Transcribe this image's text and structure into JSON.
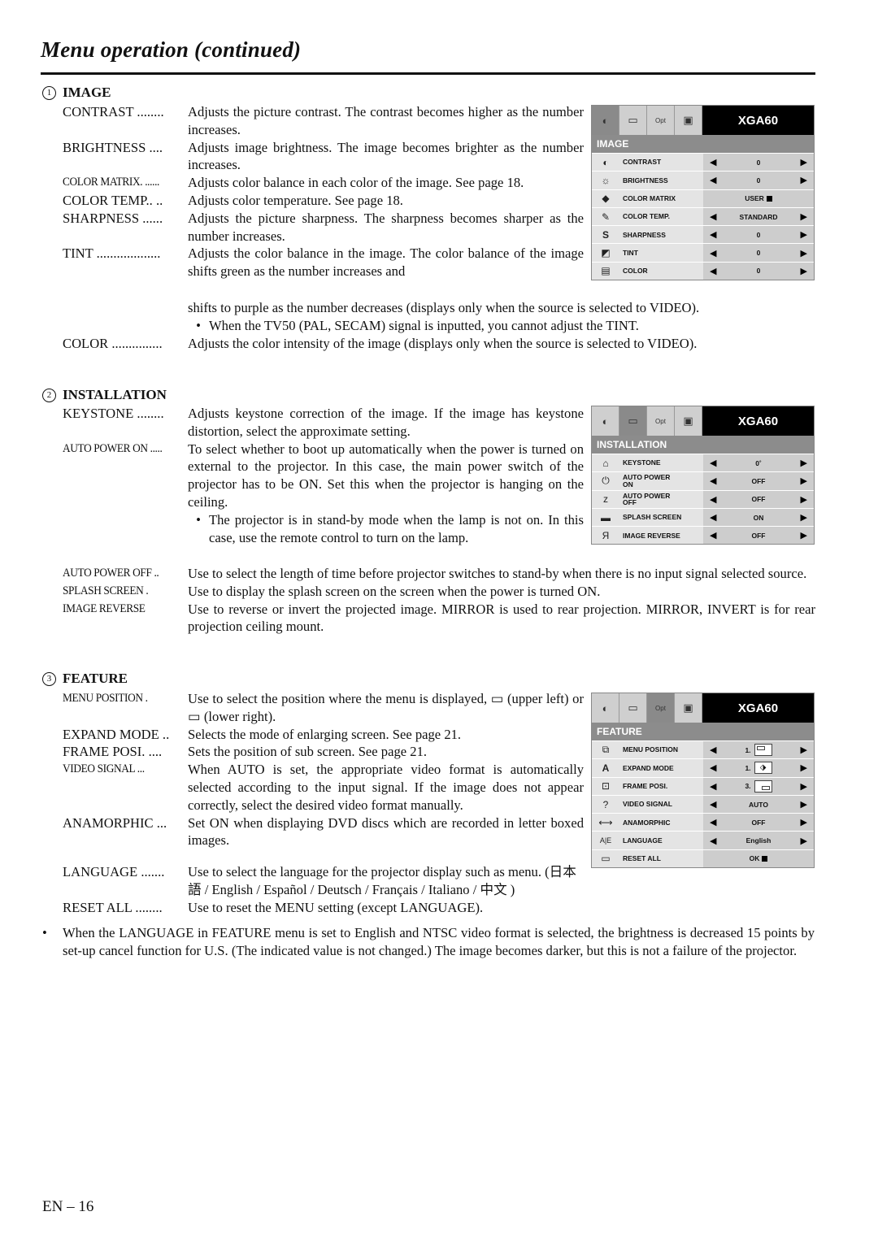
{
  "page": {
    "title": "Menu operation (continued)",
    "footer": "EN – 16"
  },
  "sections": {
    "image": {
      "num": "1",
      "heading": "IMAGE",
      "entries": [
        {
          "term": "CONTRAST ........",
          "desc": "Adjusts the picture contrast. The contrast becomes higher as the number increases."
        },
        {
          "term": "BRIGHTNESS ....",
          "desc": "Adjusts image brightness. The image becomes brighter as the number increases."
        },
        {
          "term": "COLOR MATRIX. ......",
          "desc": "Adjusts color balance in each color of the image. See page 18."
        },
        {
          "term": "COLOR TEMP.. ..",
          "desc": "Adjusts color temperature. See page 18."
        },
        {
          "term": "SHARPNESS ......",
          "desc": "Adjusts the picture sharpness. The sharpness becomes sharper as the number increases."
        },
        {
          "term": "TINT ...................",
          "desc": "Adjusts the color balance in the image. The color balance of the image shifts green as the number increases and"
        },
        {
          "term": "COLOR ...............",
          "desc": "Adjusts the color intensity of the image (displays only when the source is selected to VIDEO)."
        }
      ],
      "tint_continued": "shifts to purple as the number decreases (displays only when the source is selected to VIDEO).",
      "tint_bullet": "When the TV50 (PAL, SECAM) signal is inputted, you cannot adjust the TINT."
    },
    "installation": {
      "num": "2",
      "heading": "INSTALLATION",
      "entries": [
        {
          "term": "KEYSTONE ........",
          "desc": "Adjusts keystone correction of the image. If the image has keystone distortion, select the approximate setting."
        },
        {
          "term": "AUTO POWER ON .....",
          "desc": "To select whether to boot up automatically when the power is turned on external to the projector. In this case, the main power switch of the projector has to be ON. Set this when the projector is hanging on the ceiling."
        },
        {
          "term": "AUTO POWER OFF ..",
          "desc": "Use to select the length of time before projector switches to stand-by when there is no input signal selected source."
        },
        {
          "term": "SPLASH SCREEN .",
          "desc": "Use to display the splash screen on the screen when the power is turned ON."
        },
        {
          "term": "IMAGE REVERSE",
          "desc": "Use to reverse or invert the projected image.  MIRROR is used to rear projection. MIRROR, INVERT is for rear projection ceiling mount."
        }
      ],
      "power_on_bullet": "The projector is in stand-by mode when the lamp is not on. In this case, use the remote control to turn on the lamp."
    },
    "feature": {
      "num": "3",
      "heading": "FEATURE",
      "entries": [
        {
          "term": "MENU POSITION .",
          "desc": "Use to select the position where the menu is displayed, ▭ (upper left) or ▭ (lower right)."
        },
        {
          "term": "EXPAND MODE ..",
          "desc": "Selects the mode of enlarging screen. See page 21."
        },
        {
          "term": "FRAME POSI. ....",
          "desc": "Sets the position of sub screen. See page 21."
        },
        {
          "term": "VIDEO SIGNAL ...",
          "desc": "When AUTO is set, the appropriate video format is automatically selected according to the input signal. If the image does not appear correctly, select the desired video format manually."
        },
        {
          "term": "ANAMORPHIC ...",
          "desc": "Set ON when displaying DVD discs which are recorded in letter boxed images."
        },
        {
          "term": "LANGUAGE .......",
          "desc": "Use to select the language for the projector display such as menu. (日本語 / English / Español / Deutsch / Français / Italiano / 中文 )"
        },
        {
          "term": "RESET ALL ........",
          "desc": "Use to reset the MENU setting (except LANGUAGE)."
        }
      ]
    }
  },
  "note": "When the LANGUAGE in FEATURE menu is set to English and NTSC video format is selected, the brightness is decreased 15 points by set-up cancel function for U.S. (The indicated value is not changed.) The image becomes darker, but this is not a failure of the projector.",
  "osd": {
    "brand": "XGA60",
    "tab_opt_label": "Opt",
    "image_menu": {
      "heading": "IMAGE",
      "rows": [
        {
          "label": "CONTRAST",
          "value": "0",
          "icon": "contrast-icon"
        },
        {
          "label": "BRIGHTNESS",
          "value": "0",
          "icon": "brightness-icon"
        },
        {
          "label": "COLOR MATRIX",
          "value": "USER",
          "icon": "color-matrix-icon"
        },
        {
          "label": "COLOR TEMP.",
          "value": "STANDARD",
          "icon": "color-temp-icon"
        },
        {
          "label": "SHARPNESS",
          "value": "0",
          "icon": "sharpness-icon"
        },
        {
          "label": "TINT",
          "value": "0",
          "icon": "tint-icon"
        },
        {
          "label": "COLOR",
          "value": "0",
          "icon": "color-icon"
        }
      ]
    },
    "installation_menu": {
      "heading": "INSTALLATION",
      "rows": [
        {
          "label": "KEYSTONE",
          "value": "0˚",
          "icon": "keystone-icon"
        },
        {
          "label": "AUTO POWER ON",
          "value": "OFF",
          "icon": "auto-power-on-icon"
        },
        {
          "label": "AUTO POWER OFF",
          "value": "OFF",
          "icon": "auto-power-off-icon"
        },
        {
          "label": "SPLASH SCREEN",
          "value": "ON",
          "icon": "splash-screen-icon"
        },
        {
          "label": "IMAGE REVERSE",
          "value": "OFF",
          "icon": "image-reverse-icon"
        }
      ]
    },
    "feature_menu": {
      "heading": "FEATURE",
      "rows": [
        {
          "label": "MENU POSITION",
          "value": "1.",
          "icon": "menu-position-icon"
        },
        {
          "label": "EXPAND MODE",
          "value": "1.",
          "icon": "expand-mode-icon"
        },
        {
          "label": "FRAME POSI.",
          "value": "3.",
          "icon": "frame-posi-icon"
        },
        {
          "label": "VIDEO SIGNAL",
          "value": "AUTO",
          "icon": "video-signal-icon"
        },
        {
          "label": "ANAMORPHIC",
          "value": "OFF",
          "icon": "anamorphic-icon"
        },
        {
          "label": "LANGUAGE",
          "value": "English",
          "icon": "language-icon"
        },
        {
          "label": "RESET ALL",
          "value": "OK",
          "icon": "reset-all-icon"
        }
      ]
    }
  }
}
